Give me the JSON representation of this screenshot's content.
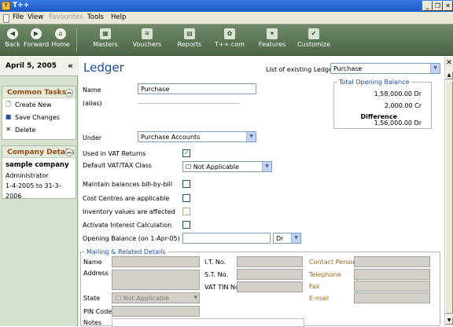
{
  "window": {
    "title": "T++",
    "minimize_label": "_",
    "restore_label": "❐",
    "close_label": "✕"
  },
  "menu": [
    {
      "label": "File",
      "disabled": false
    },
    {
      "label": "View",
      "disabled": false
    },
    {
      "label": "Favourites",
      "disabled": true
    },
    {
      "label": "Tools",
      "disabled": false
    },
    {
      "label": "Help",
      "disabled": false
    }
  ],
  "toolbar": [
    {
      "label": "Back",
      "icon": "back-icon"
    },
    {
      "label": "Forward",
      "icon": "forward-icon"
    },
    {
      "label": "Home",
      "icon": "home-icon"
    },
    {
      "label": "Masters",
      "icon": "masters-icon"
    },
    {
      "label": "Vouchers",
      "icon": "vouchers-icon"
    },
    {
      "label": "Reports",
      "icon": "reports-icon"
    },
    {
      "label": "T++.com",
      "icon": "tpp-icon"
    },
    {
      "label": "Features",
      "icon": "features-icon"
    },
    {
      "label": "Customize",
      "icon": "customize-icon"
    }
  ],
  "sidebar": {
    "date": "April 5, 2005",
    "collapse": "«",
    "common_tasks": {
      "title": "Common Tasks",
      "items": [
        {
          "label": "Create New"
        },
        {
          "label": "Save Changes"
        },
        {
          "label": "Delete"
        }
      ]
    },
    "company": {
      "title": "Company Details",
      "name": "sample company",
      "user": "Administrator",
      "period": "1-4-2005 to 31-3-2006"
    }
  },
  "ledger": {
    "heading": "Ledger",
    "list_label": "List of existing Ledger",
    "list_value": "Purchase",
    "name_label": "Name",
    "name_value": "Purchase",
    "alias_label": "(alias)",
    "under_label": "Under",
    "under_value": "Purchase Accounts",
    "vat_returns_label": "Used in VAT Returns",
    "vat_returns_checked": true,
    "vat_class_label": "Default VAT/TAX Class",
    "vat_class_value": "☐ Not Applicable",
    "bill_by_bill_label": "Maintain balances bill-by-bill",
    "cost_centres_label": "Cost Centres are applicable",
    "inventory_label": "Inventory values are affected",
    "interest_label": "Activate Interest Calculation",
    "opening_label": "Opening Balance  (on  1-Apr-05)",
    "opening_drcr": "Dr",
    "total": {
      "title": "Total Opening Balance",
      "dr_amount": "1,58,000.00  Dr",
      "cr_amount": "2,000.00  Cr",
      "difference_label": "Difference",
      "difference_amount": "1,56,000.00  Dr"
    }
  },
  "mailing": {
    "title": "Mailing & Related Details",
    "name_label": "Name",
    "address_label": "Address",
    "state_label": "State",
    "state_value": "☐ Not Applicable",
    "pin_label": "PIN Code",
    "notes_label": "Notes",
    "it_label": "I.T. No.",
    "st_label": "S.T. No.",
    "vat_tin_label": "VAT TIN No",
    "contact_label": "Contact Person",
    "telephone_label": "Telephone",
    "fax_label": "Fax",
    "email_label": "E-mail"
  },
  "colors": {
    "toolbar": "#5a7753",
    "accent": "#1b4fa0",
    "heading": "#9a4b16",
    "check": "#21a121"
  }
}
